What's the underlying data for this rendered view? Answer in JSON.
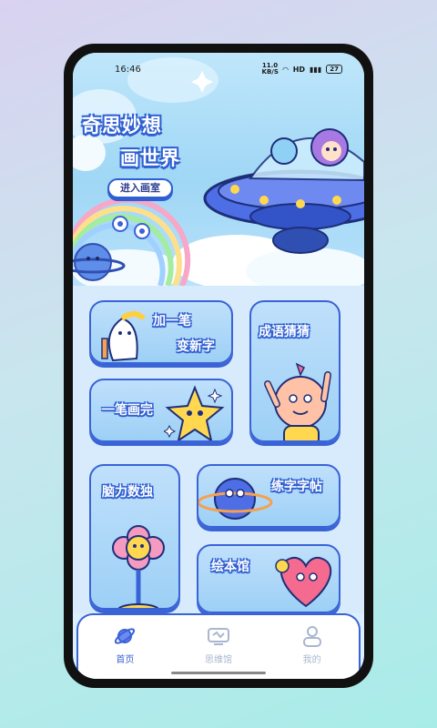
{
  "status_bar": {
    "time": "16:46",
    "speed": "11.0 KB/S",
    "battery": "27"
  },
  "hero": {
    "title_line1": "奇思妙想",
    "title_line2": "画世界",
    "enter_button": "进入画室"
  },
  "cards": {
    "add_stroke": {
      "line1": "加一笔",
      "line2": "变新字"
    },
    "idiom": {
      "title": "成语猜猜"
    },
    "one_stroke": {
      "title": "一笔画完"
    },
    "sudoku": {
      "title": "脑力数独"
    },
    "copybook": {
      "title": "练字字帖"
    },
    "picture_book": {
      "title": "绘本馆"
    }
  },
  "nav": {
    "items": [
      {
        "label": "首页",
        "icon": "planet-icon",
        "active": true
      },
      {
        "label": "思维馆",
        "icon": "brain-board-icon",
        "active": false
      },
      {
        "label": "我的",
        "icon": "user-icon",
        "active": false
      }
    ]
  },
  "colors": {
    "accent": "#3a63d6",
    "nav_inactive": "#a9b6cf",
    "card_bg": "#bfe0fb"
  }
}
